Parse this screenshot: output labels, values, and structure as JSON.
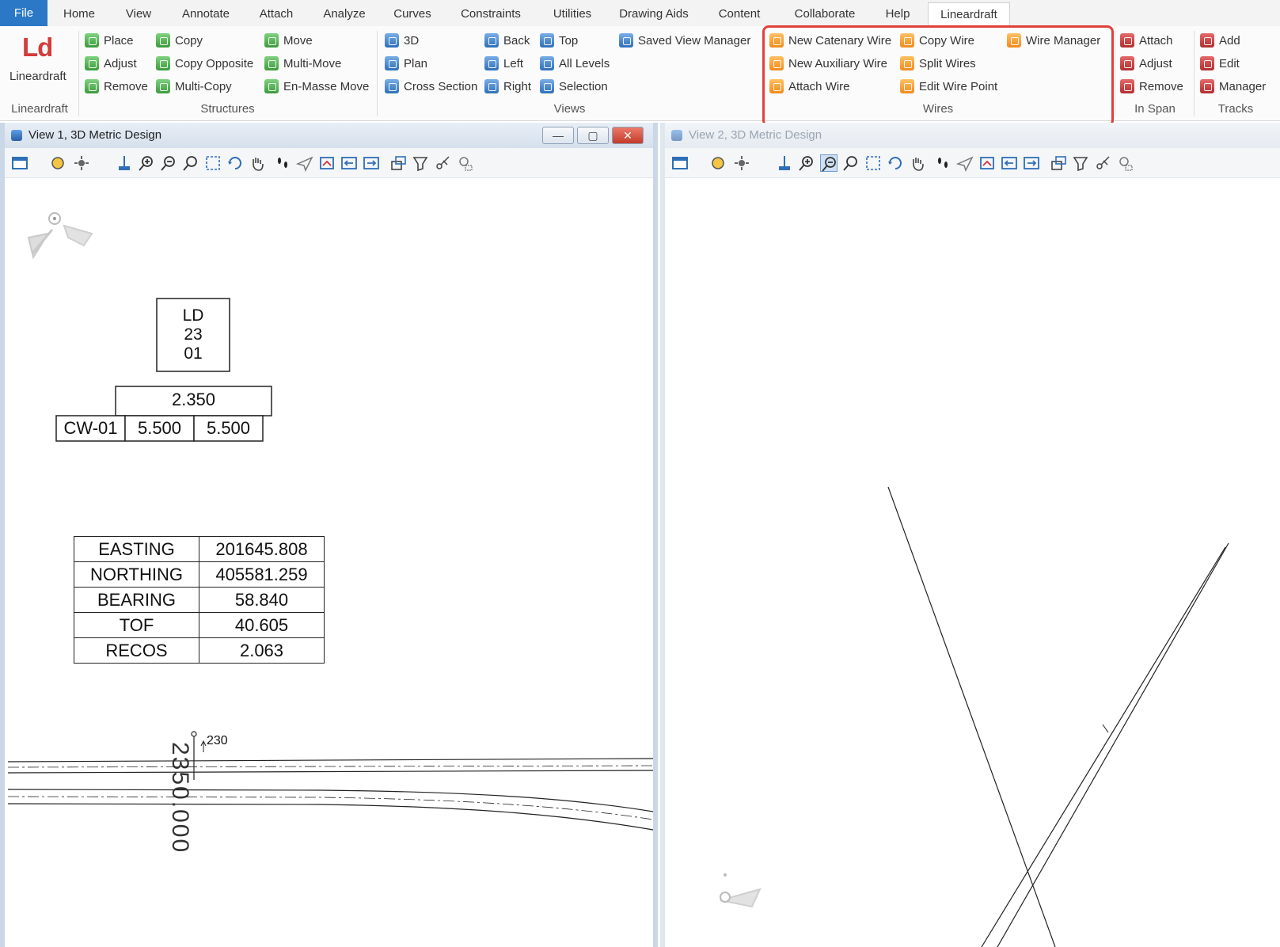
{
  "menu": {
    "tabs": [
      "File",
      "Home",
      "View",
      "Annotate",
      "Attach",
      "Analyze",
      "Curves",
      "Constraints",
      "Utilities",
      "Drawing Aids",
      "Content",
      "Collaborate",
      "Help",
      "Lineardraft"
    ],
    "active": "Lineardraft"
  },
  "ribbon": {
    "lineardraft": {
      "logo": "Ld",
      "button": "Lineardraft",
      "group": "Lineardraft"
    },
    "structures": {
      "group": "Structures",
      "col1": [
        "Place",
        "Adjust",
        "Remove"
      ],
      "col2": [
        "Copy",
        "Copy Opposite",
        "Multi-Copy"
      ],
      "col3": [
        "Move",
        "Multi-Move",
        "En-Masse Move"
      ]
    },
    "views": {
      "group": "Views",
      "col1": [
        "3D",
        "Plan",
        "Cross Section"
      ],
      "col2": [
        "Back",
        "Left",
        "Right"
      ],
      "col3": [
        "Top",
        "All Levels",
        "Selection"
      ],
      "col4": [
        "Saved View Manager"
      ]
    },
    "wires": {
      "group": "Wires",
      "col1": [
        "New Catenary Wire",
        "New Auxiliary Wire",
        "Attach Wire"
      ],
      "col2": [
        "Copy Wire",
        "Split Wires",
        "Edit Wire Point"
      ],
      "col3": [
        "Wire Manager"
      ]
    },
    "inspan": {
      "group": "In Span",
      "items": [
        "Attach",
        "Adjust",
        "Remove"
      ]
    },
    "tracks": {
      "group": "Tracks",
      "items": [
        "Add",
        "Edit",
        "Manager"
      ]
    }
  },
  "view1": {
    "title": "View 1, 3D Metric Design",
    "structure_label": [
      "LD",
      "23",
      "01"
    ],
    "span_top": "2.350",
    "wire_id": "CW-01",
    "span_left": "5.500",
    "span_right": "5.500",
    "coords": [
      {
        "k": "EASTING",
        "v": "201645.808"
      },
      {
        "k": "NORTHING",
        "v": "405581.259"
      },
      {
        "k": "BEARING",
        "v": "58.840"
      },
      {
        "k": "TOF",
        "v": "40.605"
      },
      {
        "k": "RECOS",
        "v": "2.063"
      }
    ],
    "marker_label": "230",
    "chainage": "2350.000"
  },
  "view2": {
    "title": "View 2, 3D Metric Design"
  },
  "window_buttons": {
    "minimize": "—",
    "maximize": "▢",
    "close": "✕"
  },
  "colors": {
    "file_tab": "#2b78c7",
    "highlight": "#e0413b"
  }
}
